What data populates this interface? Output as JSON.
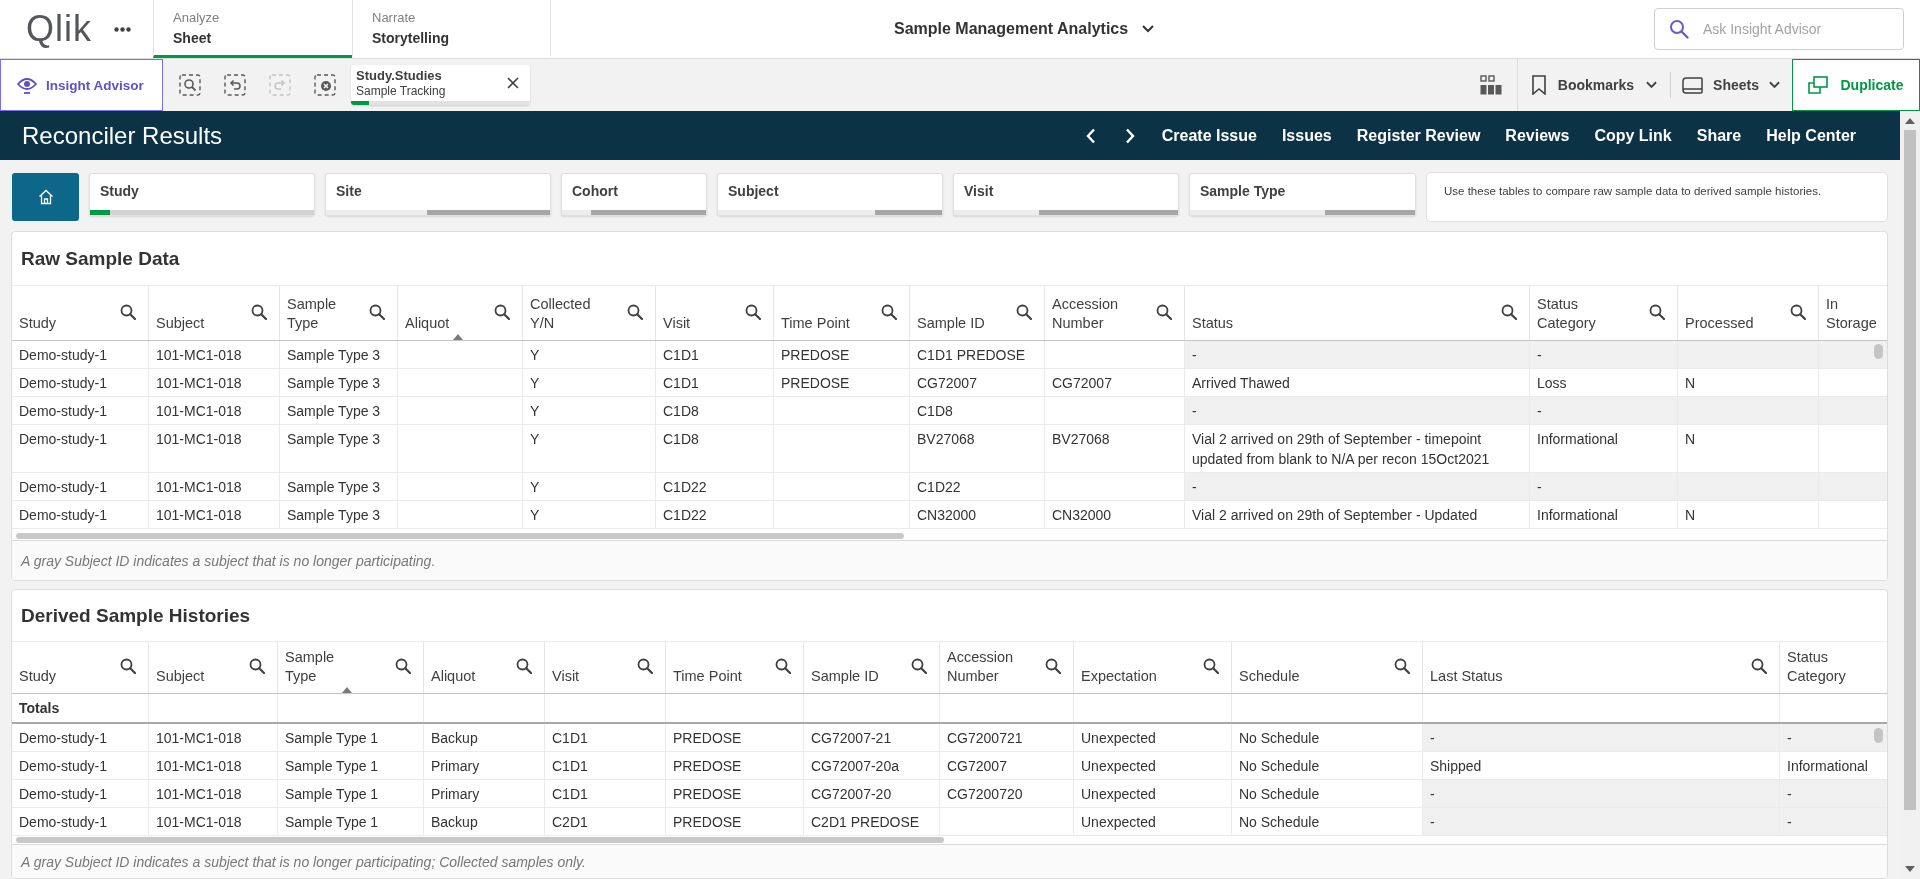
{
  "top_bar": {
    "logo": "Qlik",
    "tabs": [
      {
        "category": "Analyze",
        "label": "Sheet",
        "selected": true
      },
      {
        "category": "Narrate",
        "label": "Storytelling",
        "selected": false
      }
    ],
    "app_title": "Sample Management Analytics",
    "search": {
      "placeholder": "Ask Insight Advisor"
    }
  },
  "toolbar": {
    "insight_button": "Insight Advisor",
    "selection_tools": [
      {
        "kind": "search",
        "disabled": false
      },
      {
        "kind": "back",
        "disabled": false
      },
      {
        "kind": "forward",
        "disabled": true
      },
      {
        "kind": "clear",
        "disabled": false
      }
    ],
    "selections": [
      {
        "field": "Study.Studies",
        "value": "Sample Tracking",
        "level": 0.1
      }
    ],
    "bookmarks": "Bookmarks",
    "sheets": "Sheets",
    "duplicate": "Duplicate"
  },
  "sheet_header": {
    "title": "Reconciler Results",
    "links": [
      "Create Issue",
      "Issues",
      "Register Review",
      "Reviews",
      "Copy Link",
      "Share",
      "Help Center"
    ]
  },
  "filters": [
    {
      "label": "Study",
      "segments": [
        {
          "kind": "selected",
          "level": 0.09
        },
        {
          "kind": "alternative",
          "level": 0.91
        }
      ]
    },
    {
      "label": "Site",
      "segments": [
        {
          "kind": "possible",
          "level": 0.45
        },
        {
          "kind": "excluded",
          "level": 0.55
        }
      ]
    },
    {
      "label": "Cohort",
      "segments": [
        {
          "kind": "possible",
          "level": 0.2
        },
        {
          "kind": "excluded",
          "level": 0.8
        }
      ]
    },
    {
      "label": "Subject",
      "segments": [
        {
          "kind": "possible",
          "level": 0.7
        },
        {
          "kind": "excluded",
          "level": 0.3
        }
      ]
    },
    {
      "label": "Visit",
      "segments": [
        {
          "kind": "possible",
          "level": 0.38
        },
        {
          "kind": "excluded",
          "level": 0.62
        }
      ]
    },
    {
      "label": "Sample Type",
      "segments": [
        {
          "kind": "possible",
          "level": 0.6
        },
        {
          "kind": "excluded",
          "level": 0.4
        }
      ]
    }
  ],
  "info_text": "Use these tables to compare raw sample data to derived sample histories.",
  "raw_table": {
    "title": "Raw Sample Data",
    "columns": [
      {
        "label": "Study",
        "searchable": true,
        "sorted": false,
        "shade": false
      },
      {
        "label": "Subject",
        "searchable": true,
        "sorted": false,
        "shade": false
      },
      {
        "label": "Sample\nType",
        "searchable": true,
        "sorted": false,
        "shade": false
      },
      {
        "label": "Aliquot",
        "searchable": true,
        "sorted": true,
        "shade": false
      },
      {
        "label": "Collected\nY/N",
        "searchable": true,
        "sorted": false,
        "shade": false
      },
      {
        "label": "Visit",
        "searchable": true,
        "sorted": false,
        "shade": false
      },
      {
        "label": "Time Point",
        "searchable": true,
        "sorted": false,
        "shade": false
      },
      {
        "label": "Sample ID",
        "searchable": true,
        "sorted": false,
        "shade": false
      },
      {
        "label": "Accession\nNumber",
        "searchable": true,
        "sorted": false,
        "shade": false
      },
      {
        "label": "Status",
        "searchable": true,
        "sorted": false,
        "shade": true
      },
      {
        "label": "Status\nCategory",
        "searchable": true,
        "sorted": false,
        "shade": true
      },
      {
        "label": "Processed",
        "searchable": true,
        "sorted": false,
        "shade": true
      },
      {
        "label": "In\nStorage",
        "searchable": false,
        "sorted": false,
        "shade": true
      }
    ],
    "rows": [
      {
        "shaded": true,
        "cells": [
          "Demo-study-1",
          "101-MC1-018",
          "Sample Type 3",
          null,
          "Y",
          "C1D1",
          "PREDOSE",
          "C1D1 PREDOSE",
          null,
          "-",
          "-",
          null,
          null
        ]
      },
      {
        "shaded": false,
        "cells": [
          "Demo-study-1",
          "101-MC1-018",
          "Sample Type 3",
          null,
          "Y",
          "C1D1",
          "PREDOSE",
          "CG72007",
          "CG72007",
          "Arrived Thawed",
          "Loss",
          "N",
          null
        ]
      },
      {
        "shaded": true,
        "cells": [
          "Demo-study-1",
          "101-MC1-018",
          "Sample Type 3",
          null,
          "Y",
          "C1D8",
          null,
          "C1D8",
          null,
          "-",
          "-",
          null,
          null
        ]
      },
      {
        "shaded": false,
        "cells": [
          "Demo-study-1",
          "101-MC1-018",
          "Sample Type 3",
          null,
          "Y",
          "C1D8",
          null,
          "BV27068",
          "BV27068",
          "Vial 2 arrived on 29th of September - timepoint updated from blank to N/A per recon 15Oct2021",
          "Informational",
          "N",
          null
        ]
      },
      {
        "shaded": true,
        "cells": [
          "Demo-study-1",
          "101-MC1-018",
          "Sample Type 3",
          null,
          "Y",
          "C1D22",
          null,
          "C1D22",
          null,
          "-",
          "-",
          null,
          null
        ]
      },
      {
        "shaded": false,
        "cells": [
          "Demo-study-1",
          "101-MC1-018",
          "Sample Type 3",
          null,
          "Y",
          "C1D22",
          null,
          "CN32000",
          "CN32000",
          "Vial 2 arrived on 29th of September - Updated",
          "Informational",
          "N",
          null
        ]
      }
    ],
    "footnote": "A gray Subject ID indicates a subject that is no longer participating."
  },
  "derived_table": {
    "title": "Derived Sample Histories",
    "columns": [
      {
        "label": "Study",
        "searchable": true,
        "sorted": false,
        "shade": false
      },
      {
        "label": "Subject",
        "searchable": true,
        "sorted": false,
        "shade": false
      },
      {
        "label": "Sample\nType",
        "searchable": true,
        "sorted": true,
        "shade": false
      },
      {
        "label": "Aliquot",
        "searchable": true,
        "sorted": false,
        "shade": false
      },
      {
        "label": "Visit",
        "searchable": true,
        "sorted": false,
        "shade": false
      },
      {
        "label": "Time Point",
        "searchable": true,
        "sorted": false,
        "shade": false
      },
      {
        "label": "Sample ID",
        "searchable": true,
        "sorted": false,
        "shade": false
      },
      {
        "label": "Accession\nNumber",
        "searchable": true,
        "sorted": false,
        "shade": false
      },
      {
        "label": "Expectation",
        "searchable": true,
        "sorted": false,
        "shade": false
      },
      {
        "label": "Schedule",
        "searchable": true,
        "sorted": false,
        "shade": false
      },
      {
        "label": "Last Status",
        "searchable": true,
        "sorted": false,
        "shade": true
      },
      {
        "label": "Status\nCategory",
        "searchable": false,
        "sorted": false,
        "shade": true
      }
    ],
    "totals": "Totals",
    "rows": [
      {
        "shaded": true,
        "cells": [
          "Demo-study-1",
          "101-MC1-018",
          "Sample Type 1",
          "Backup",
          "C1D1",
          "PREDOSE",
          "CG72007-21",
          "CG7200721",
          "Unexpected",
          "No Schedule",
          "-",
          "-"
        ]
      },
      {
        "shaded": false,
        "cells": [
          "Demo-study-1",
          "101-MC1-018",
          "Sample Type 1",
          "Primary",
          "C1D1",
          "PREDOSE",
          "CG72007-20a",
          "CG72007",
          "Unexpected",
          "No Schedule",
          "Shipped",
          "Informational"
        ]
      },
      {
        "shaded": true,
        "cells": [
          "Demo-study-1",
          "101-MC1-018",
          "Sample Type 1",
          "Primary",
          "C1D1",
          "PREDOSE",
          "CG72007-20",
          "CG7200720",
          "Unexpected",
          "No Schedule",
          "-",
          "-"
        ]
      },
      {
        "shaded": true,
        "cells": [
          "Demo-study-1",
          "101-MC1-018",
          "Sample Type 1",
          "Backup",
          "C2D1",
          "PREDOSE",
          "C2D1 PREDOSE",
          null,
          "Unexpected",
          "No Schedule",
          "-",
          "-"
        ]
      }
    ],
    "footnote": "A gray Subject ID indicates a subject that is no longer participating; Collected samples only."
  }
}
